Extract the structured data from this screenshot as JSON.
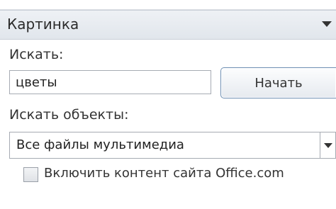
{
  "panel": {
    "title": "Картинка",
    "dropdown_icon": "chevron-down-icon"
  },
  "search": {
    "label": "Искать:",
    "value": "цветы",
    "go_button": "Начать"
  },
  "filter": {
    "label": "Искать объекты:",
    "selected": "Все файлы мультимедиа",
    "dropdown_icon": "chevron-down-icon"
  },
  "office_content": {
    "label": "Включить контент сайта Office.com",
    "checked": false
  },
  "colors": {
    "title_bar": "#e1e6ec",
    "button_border": "#6e8fb3",
    "field_border": "#a6abb3"
  }
}
